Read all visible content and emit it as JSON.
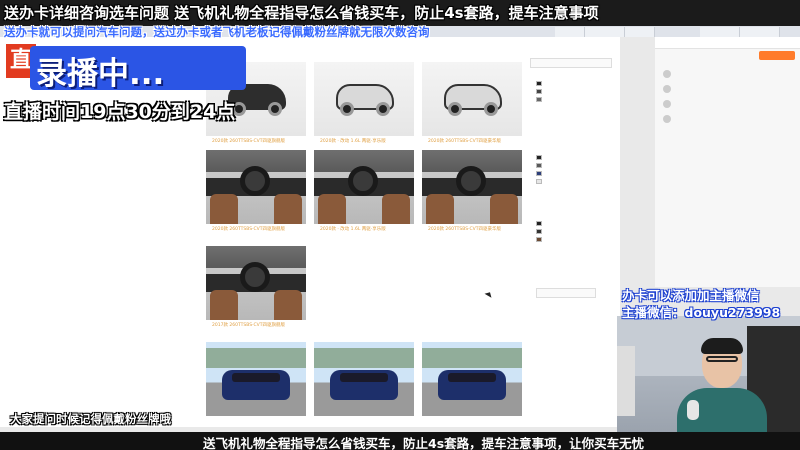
{
  "overlays": {
    "top_ticker": "送办卡详细咨询选车问题  送飞机礼物全程指导怎么省钱买车，防止4s套路，提车注意事项",
    "second_ticker": "送办卡就可以提问汽车问题，送过办卡或者飞机老板记得佩戴粉丝牌就无限次数咨询",
    "recording_label": "录播中...",
    "stream_time": "直播时间19点30分到24点",
    "fan_badge_note": "大家提问时候记得佩戴粉丝牌哦",
    "wechat_line1": "办卡可以添加加主播微信",
    "wechat_line2": "主播微信：douyu273998",
    "bottom_ticker": "送飞机礼物全程指导怎么省钱买车，防止4s套路，提车注意事项，让你买车无忧"
  },
  "page": {
    "brand_char": "直"
  },
  "gallery": {
    "captions": [
      "2020款 260TTSBS·CVT四驱旗舰版",
      "2020款 · 改动 1.6L 两驱·享乐版",
      "2020款 260TTSBS·CVT四驱豪华版",
      "2020款 260TTSBS·CVT四驱旗舰版",
      "2020款 · 改动 1.6L 两驱·享乐版",
      "2020款 260TTSBS·CVT四驱豪华版",
      "2017款 260TTSBS·CVT四驱旗舰版"
    ]
  },
  "colors": {
    "accent": "#ff7b2b",
    "ticker_blue": "#3a6bff",
    "recording_blue": "#2b55e5"
  }
}
